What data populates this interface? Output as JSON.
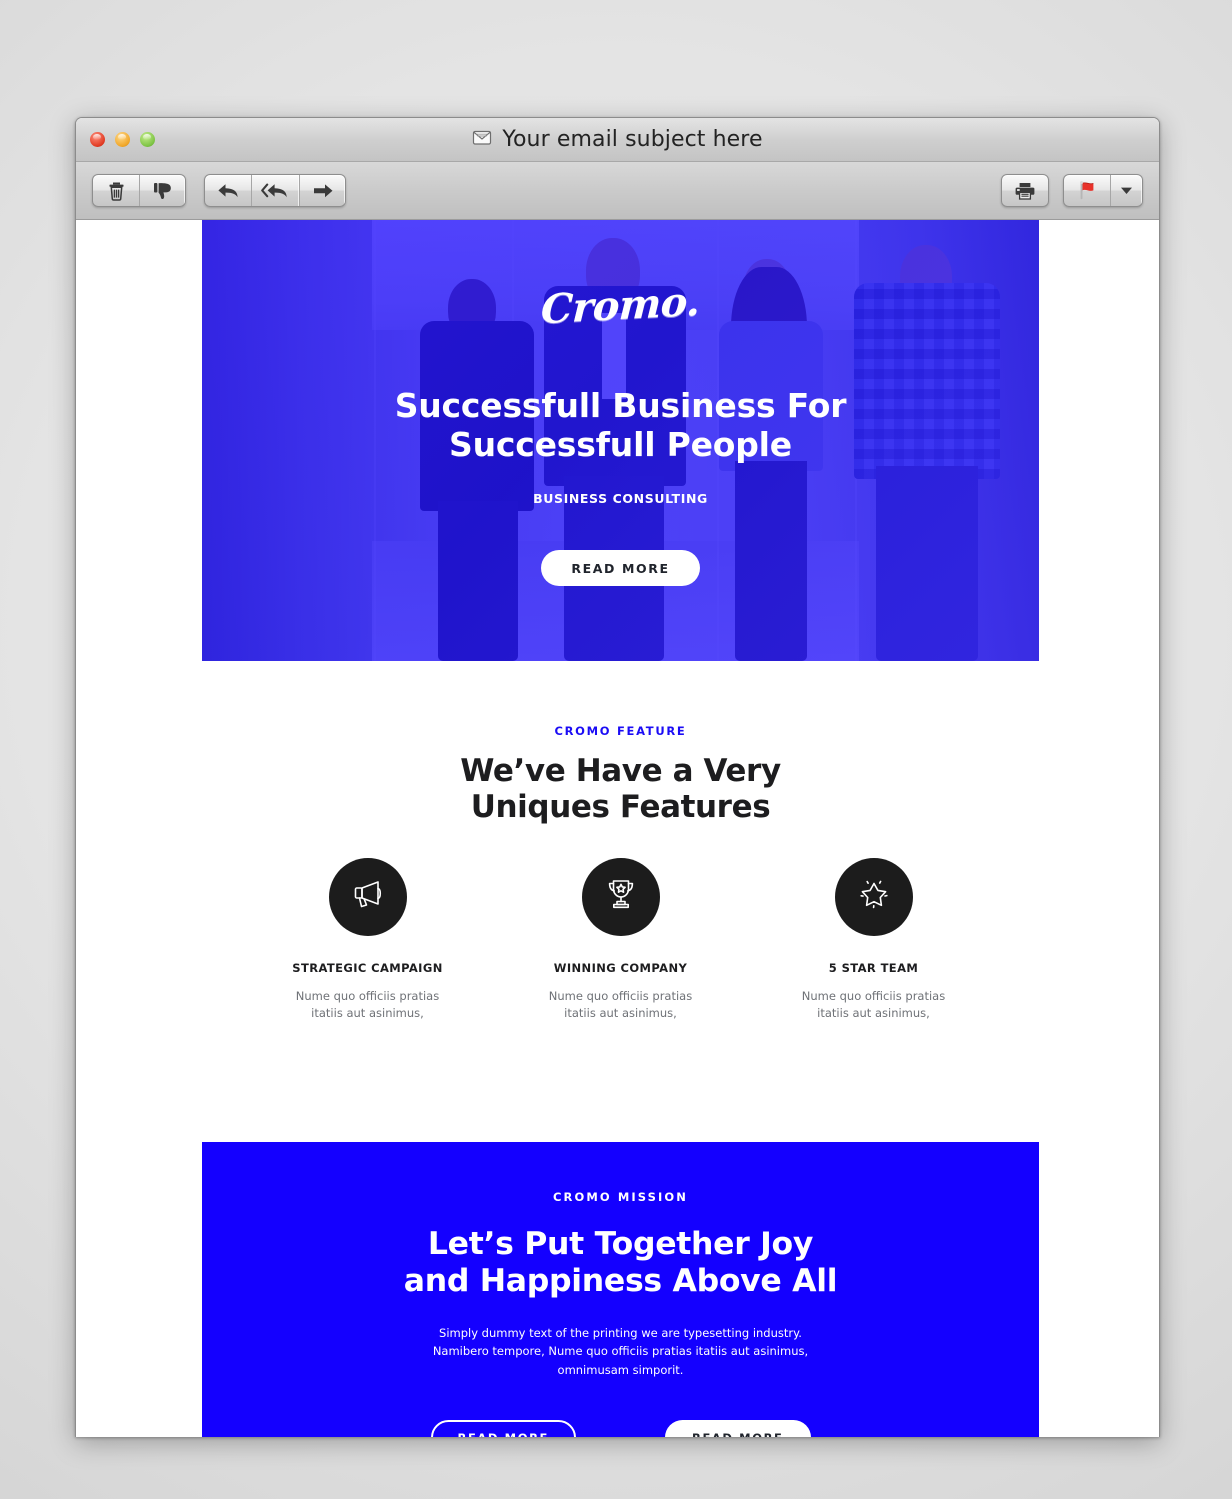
{
  "window": {
    "title": "Your email subject here",
    "title_icon": "envelope-icon",
    "traffic_lights": [
      "close",
      "minimize",
      "maximize"
    ],
    "toolbar": {
      "delete_label": "Delete",
      "junk_label": "Junk",
      "reply_label": "Reply",
      "reply_all_label": "Reply All",
      "forward_label": "Forward",
      "print_label": "Print",
      "flag_label": "Flag",
      "flag_menu_label": "Flag options",
      "icons": [
        "trash-icon",
        "thumbs-down-icon",
        "reply-arrow-icon",
        "reply-all-arrow-icon",
        "forward-arrow-icon",
        "printer-icon",
        "red-flag-icon",
        "chevron-down-icon"
      ]
    }
  },
  "colors": {
    "brand_blue": "#1400ff",
    "hero_overlay": "#2a14ff",
    "dark_circle": "#1c1c1c",
    "heading": "#1d1d1f",
    "body_text": "#6f7277"
  },
  "hero": {
    "logo": "Cromo.",
    "heading_line1": "Successfull Business For",
    "heading_line2": "Successfull People",
    "subtitle": "BUSINESS CONSULTING",
    "cta": "READ MORE"
  },
  "features": {
    "eyebrow": "CROMO FEATURE",
    "heading_line1": "We’ve Have a Very",
    "heading_line2": "Uniques Features",
    "items": [
      {
        "icon": "megaphone-icon",
        "title": "STRATEGIC CAMPAIGN",
        "text_line1": "Nume quo officiis pratias",
        "text_line2": "itatiis aut asinimus,"
      },
      {
        "icon": "trophy-icon",
        "title": "WINNING COMPANY",
        "text_line1": "Nume quo officiis pratias",
        "text_line2": "itatiis aut asinimus,"
      },
      {
        "icon": "star-icon",
        "title": "5 STAR TEAM",
        "text_line1": "Nume quo officiis pratias",
        "text_line2": "itatiis aut asinimus,"
      }
    ]
  },
  "mission": {
    "eyebrow": "CROMO MISSION",
    "heading_line1": "Let’s Put Together Joy",
    "heading_line2": "and Happiness Above All",
    "text_line1": "Simply dummy text of the printing we are typesetting industry.",
    "text_line2": "Namibero tempore, Nume quo officiis pratias itatiis aut asinimus,",
    "text_line3": "omnimusam simporit.",
    "cta_outline": "READ MORE",
    "cta_solid": "READ MORE"
  }
}
